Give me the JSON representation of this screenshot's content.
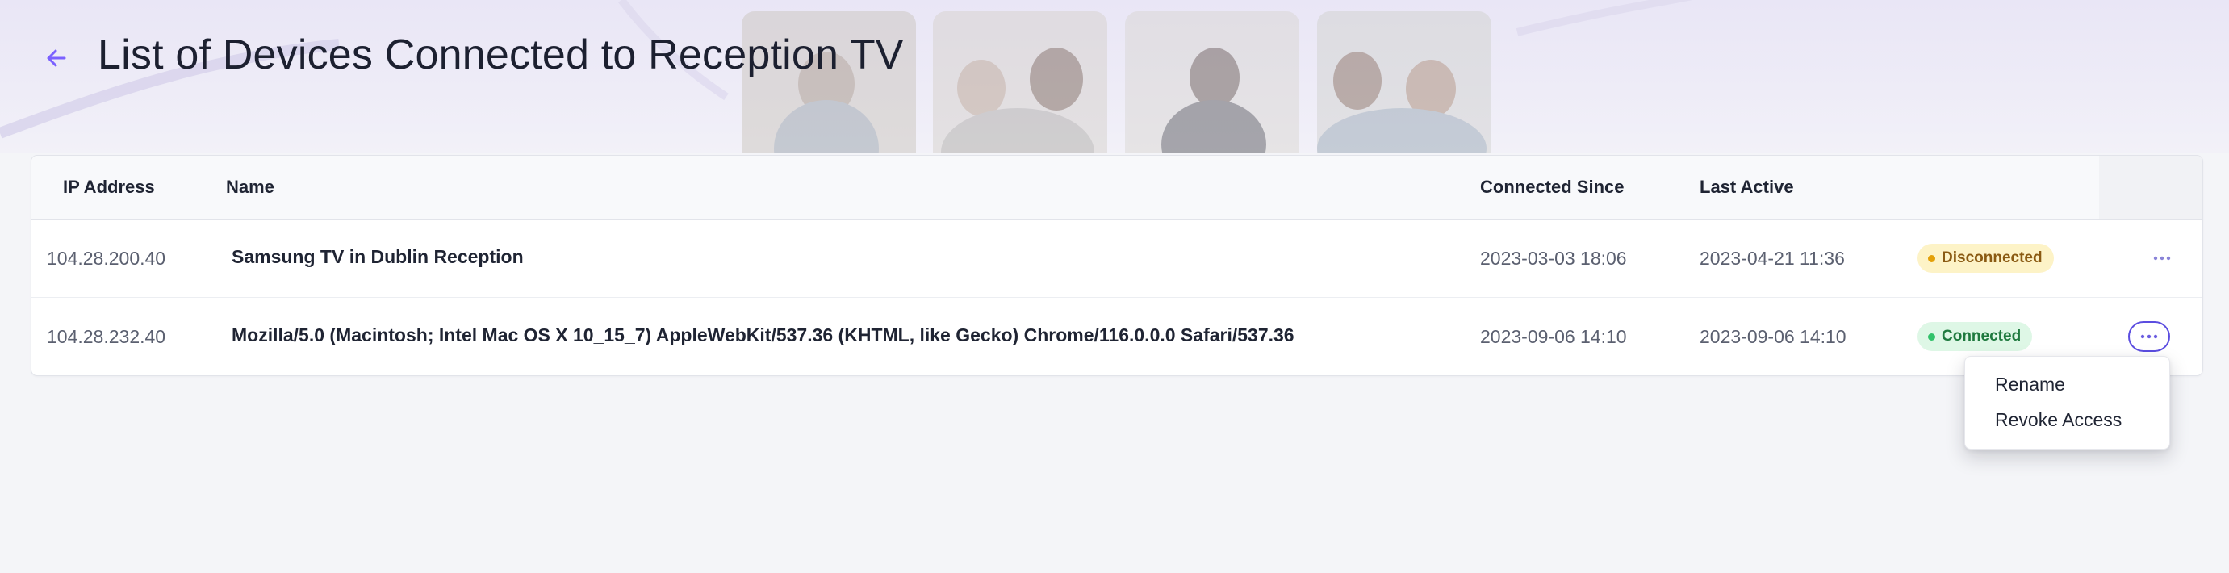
{
  "header": {
    "title": "List of Devices Connected to Reception TV",
    "back_icon": "arrow-left-icon",
    "accent_color": "#7b61ff"
  },
  "table": {
    "columns": {
      "ip": "IP Address",
      "name": "Name",
      "connected_since": "Connected Since",
      "last_active": "Last Active"
    },
    "rows": [
      {
        "ip": "104.28.200.40",
        "name": "Samsung TV in Dublin Reception",
        "connected_since": "2023-03-03 18:06",
        "last_active": "2023-04-21 11:36",
        "status": "Disconnected",
        "status_color": "#e3a008",
        "actions_icon": "more-horizontal-icon"
      },
      {
        "ip": "104.28.232.40",
        "name": "Mozilla/5.0 (Macintosh; Intel Mac OS X 10_15_7) AppleWebKit/537.36 (KHTML, like Gecko) Chrome/116.0.0.0 Safari/537.36",
        "connected_since": "2023-09-06 14:10",
        "last_active": "2023-09-06 14:10",
        "status": "Connected",
        "status_color": "#31c26a",
        "actions_icon": "more-horizontal-icon"
      }
    ]
  },
  "actions_menu": {
    "items": [
      "Rename",
      "Revoke Access"
    ]
  }
}
